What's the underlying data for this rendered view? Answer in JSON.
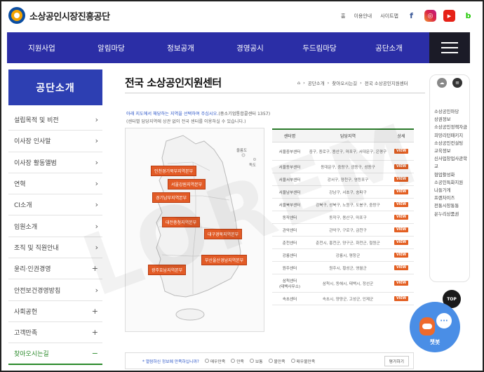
{
  "header": {
    "logo_text": "소상공인시장진흥공단",
    "utils": [
      "홈",
      "이용안내",
      "사이트맵"
    ],
    "sns_icons": [
      "facebook-icon",
      "instagram-icon",
      "youtube-icon",
      "blog-icon"
    ],
    "sns_glyphs": [
      "f",
      "◎",
      "▶",
      "b"
    ]
  },
  "nav": {
    "items": [
      "지원사업",
      "알림마당",
      "정보공개",
      "경영공시",
      "두드림마당",
      "공단소개"
    ]
  },
  "sidebar": {
    "title": "공단소개",
    "items": [
      {
        "label": "설립목적 및 비전",
        "arrow": "›"
      },
      {
        "label": "이사장 인사말",
        "arrow": "›"
      },
      {
        "label": "이사장 활동앨범",
        "arrow": "›"
      },
      {
        "label": "연혁",
        "arrow": "›"
      },
      {
        "label": "CI소개",
        "arrow": "›"
      },
      {
        "label": "임원소개",
        "arrow": "›"
      },
      {
        "label": "조직 및 직원안내",
        "arrow": "›"
      },
      {
        "label": "윤리·인권경영",
        "arrow": "+"
      },
      {
        "label": "안전보건경영방침",
        "arrow": "›"
      },
      {
        "label": "사회공헌",
        "arrow": "+"
      },
      {
        "label": "고객만족",
        "arrow": "+"
      },
      {
        "label": "찾아오시는길",
        "arrow": "−"
      }
    ]
  },
  "main": {
    "title": "전국 소상공인지원센터",
    "breadcrumb": [
      "공단소개",
      "찾아오시는길",
      "전국 소상공인지원센터"
    ],
    "note_highlight": "아래 지도에서 해당하는 지역을 선택하여 주십시오.",
    "note_phone": "(중소기업통합콜센터 1357)",
    "note_line2": "(센터별 담당지역에 상관 없이 전국 센터를 이용하실 수 있습니다.)"
  },
  "map": {
    "island_labels": [
      "울릉도",
      "독도"
    ],
    "regions": [
      "인천경기북부지역본부",
      "서울강원지역본부",
      "경기남부지역본부",
      "대전충청지역본부",
      "대구경북지역본부",
      "부산울산경남지역본부",
      "광주호남지역본부"
    ],
    "land_color": "#f3f3f3",
    "label_color": "#e25b26"
  },
  "table": {
    "headers": [
      "센터명",
      "담당지역",
      "상세"
    ],
    "view_label": "VIEW",
    "rows": [
      {
        "name": "서울중부센터",
        "area": "중구, 종로구, 용산구, 마포구, 서대문구, 은평구"
      },
      {
        "name": "서울동부센터",
        "area": "동대문구, 중랑구, 광동구, 성동구"
      },
      {
        "name": "서울서부센터",
        "area": "강서구, 양천구, 영등포구"
      },
      {
        "name": "서울남부센터",
        "area": "강남구, 서초구, 송파구"
      },
      {
        "name": "서울북부센터",
        "area": "강북구, 성북구, 노원구, 도봉구, 중랑구"
      },
      {
        "name": "동작센터",
        "area": "동작구, 용산구, 마포구"
      },
      {
        "name": "관악센터",
        "area": "관악구, 구로구, 금천구"
      },
      {
        "name": "춘천센터",
        "area": "춘천시, 홍천군, 양구군, 화천군, 철원군"
      },
      {
        "name": "강릉센터",
        "area": "강릉시, 평창군"
      },
      {
        "name": "원주센터",
        "area": "원주시, 횡성군, 영월군"
      },
      {
        "name": "삼척센터\n(태백사무소)",
        "area": "삼척시, 동해시, 태백시, 정선군"
      },
      {
        "name": "속초센터",
        "area": "속초시, 양양군, 고성군, 인제군"
      }
    ]
  },
  "right_sidebar": {
    "links": [
      "소상공인마당",
      "상권정보",
      "소상공인정책자금",
      "희망리턴패키지",
      "소상공인컨설팅",
      "교육정보",
      "신사업창업사관학교",
      "협업활성화",
      "소공인특화지원",
      "나들가게",
      "프랜차이즈",
      "전통시장통통",
      "온누리상품권"
    ]
  },
  "top_button": "TOP",
  "chatbot": {
    "label": "챗봇",
    "glyph": "···"
  },
  "survey": {
    "question": "열람하신 정보에 만족하십니까?",
    "options": [
      "매우만족",
      "만족",
      "보통",
      "불만족",
      "매우불만족"
    ],
    "submit": "평가하기"
  },
  "watermark": "LOREM"
}
